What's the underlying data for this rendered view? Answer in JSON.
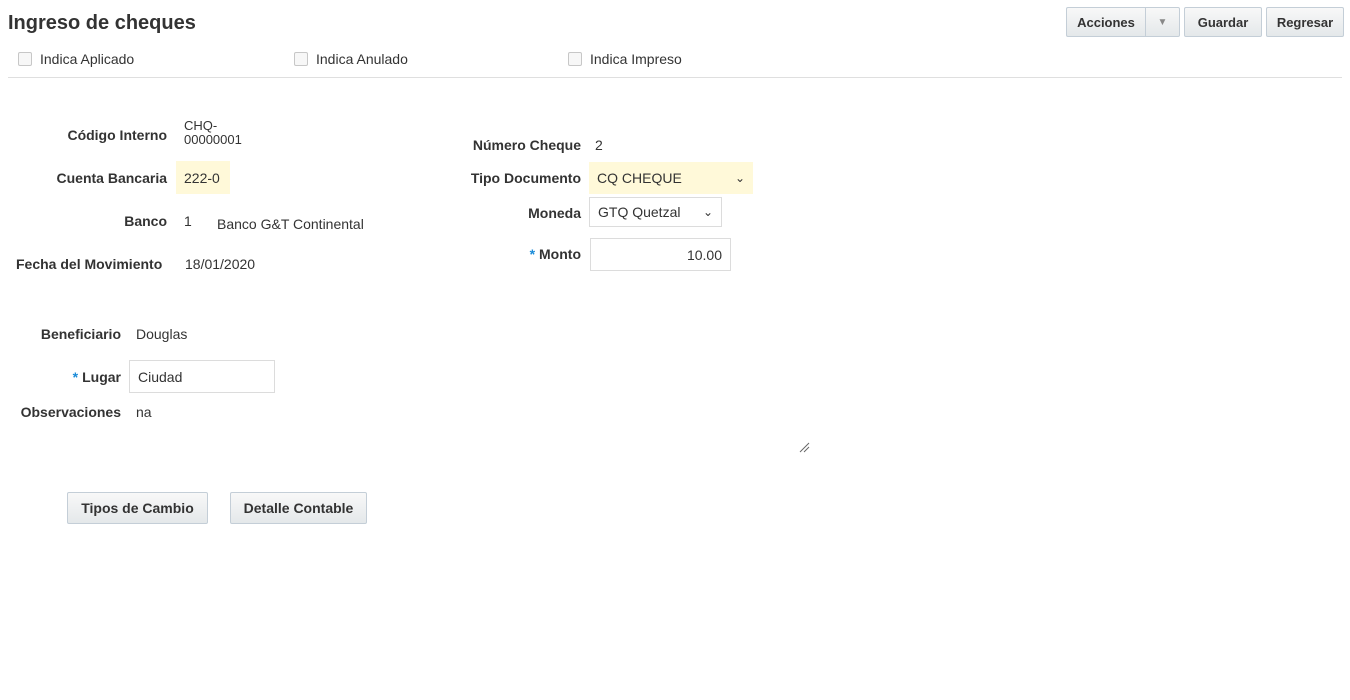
{
  "header": {
    "title": "Ingreso de cheques",
    "actions_label": "Acciones",
    "save_label": "Guardar",
    "back_label": "Regresar"
  },
  "flags": {
    "aplicado": "Indica Aplicado",
    "anulado": "Indica Anulado",
    "impreso": "Indica Impreso"
  },
  "form": {
    "codigo_label": "Código Interno",
    "codigo_line1": "CHQ-",
    "codigo_line2": "00000001",
    "cuenta_label": "Cuenta Bancaria",
    "cuenta_value": "222-0",
    "banco_label": "Banco",
    "banco_code": "1",
    "banco_name": "Banco G&T Continental",
    "fecha_label": "Fecha del Movimiento",
    "fecha_value": "18/01/2020",
    "numero_label": "Número Cheque",
    "numero_value": "2",
    "tipo_label": "Tipo Documento",
    "tipo_value": "CQ CHEQUE",
    "moneda_label": "Moneda",
    "moneda_value": "GTQ Quetzal",
    "monto_label": "Monto",
    "monto_value": "10.00",
    "required_mark": "*",
    "beneficiario_label": "Beneficiario",
    "beneficiario_value": "Douglas",
    "lugar_label": "Lugar",
    "lugar_value": "Ciudad",
    "observaciones_label": "Observaciones",
    "observaciones_value": "na"
  },
  "buttons": {
    "tipos_cambio": "Tipos de Cambio",
    "detalle_contable": "Detalle Contable"
  }
}
